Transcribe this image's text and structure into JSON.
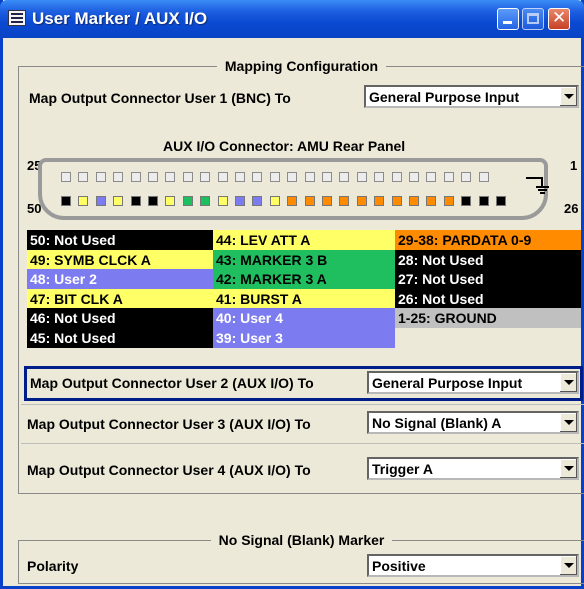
{
  "window": {
    "title": "User Marker / AUX I/O"
  },
  "colors": {
    "black": "#000000",
    "yellow": "#ffff66",
    "blue": "#7c7cf0",
    "green": "#1fbf5f",
    "orange": "#ff8c00",
    "gray": "#c0c0c0",
    "titlebar": "#0a4ad2",
    "selection_border": "#001e8a"
  },
  "mapping": {
    "group_title": "Mapping Configuration",
    "user1_label": "Map Output Connector User 1 (BNC) To",
    "user1_value": "General Purpose Input",
    "aux_title": "AUX I/O Connector: AMU Rear Panel",
    "pin_labels": {
      "top_left": "25",
      "top_right": "1",
      "bottom_left": "50",
      "bottom_right": "26"
    },
    "bottom_pins": [
      "black",
      "yellow",
      "blue",
      "yellow",
      "black",
      "black",
      "yellow",
      "green",
      "green",
      "yellow",
      "blue",
      "blue",
      "yellow",
      "orange",
      "orange",
      "orange",
      "orange",
      "orange",
      "orange",
      "orange",
      "orange",
      "orange",
      "orange",
      "black",
      "black",
      "black"
    ],
    "legend": [
      {
        "text": "50: Not Used",
        "color": "black"
      },
      {
        "text": "44: LEV ATT A",
        "color": "yellow"
      },
      {
        "text": "29-38: PARDATA 0-9",
        "color": "orange"
      },
      {
        "text": "49: SYMB CLCK A",
        "color": "yellow"
      },
      {
        "text": "43: MARKER 3 B",
        "color": "green"
      },
      {
        "text": "28:  Not Used",
        "color": "black"
      },
      {
        "text": "48: User 2",
        "color": "blue"
      },
      {
        "text": "42: MARKER 3 A",
        "color": "green"
      },
      {
        "text": "27:  Not Used",
        "color": "black"
      },
      {
        "text": "47: BIT CLK A",
        "color": "yellow"
      },
      {
        "text": "41: BURST A",
        "color": "yellow"
      },
      {
        "text": "26: Not Used",
        "color": "black"
      },
      {
        "text": "46: Not Used",
        "color": "black"
      },
      {
        "text": "40: User 4",
        "color": "blue"
      },
      {
        "text": "1-25: GROUND",
        "color": "gray"
      },
      {
        "text": "45: Not Used",
        "color": "black"
      },
      {
        "text": "39: User 3",
        "color": "blue"
      }
    ],
    "user2_label": "Map Output Connector User 2 (AUX I/O) To",
    "user2_value": "General Purpose Input",
    "user3_label": "Map Output Connector User 3 (AUX I/O) To",
    "user3_value": "No Signal (Blank) A",
    "user4_label": "Map Output Connector User 4 (AUX I/O) To",
    "user4_value": "Trigger A"
  },
  "blank_marker": {
    "group_title": "No Signal (Blank) Marker",
    "polarity_label": "Polarity",
    "polarity_value": "Positive"
  }
}
